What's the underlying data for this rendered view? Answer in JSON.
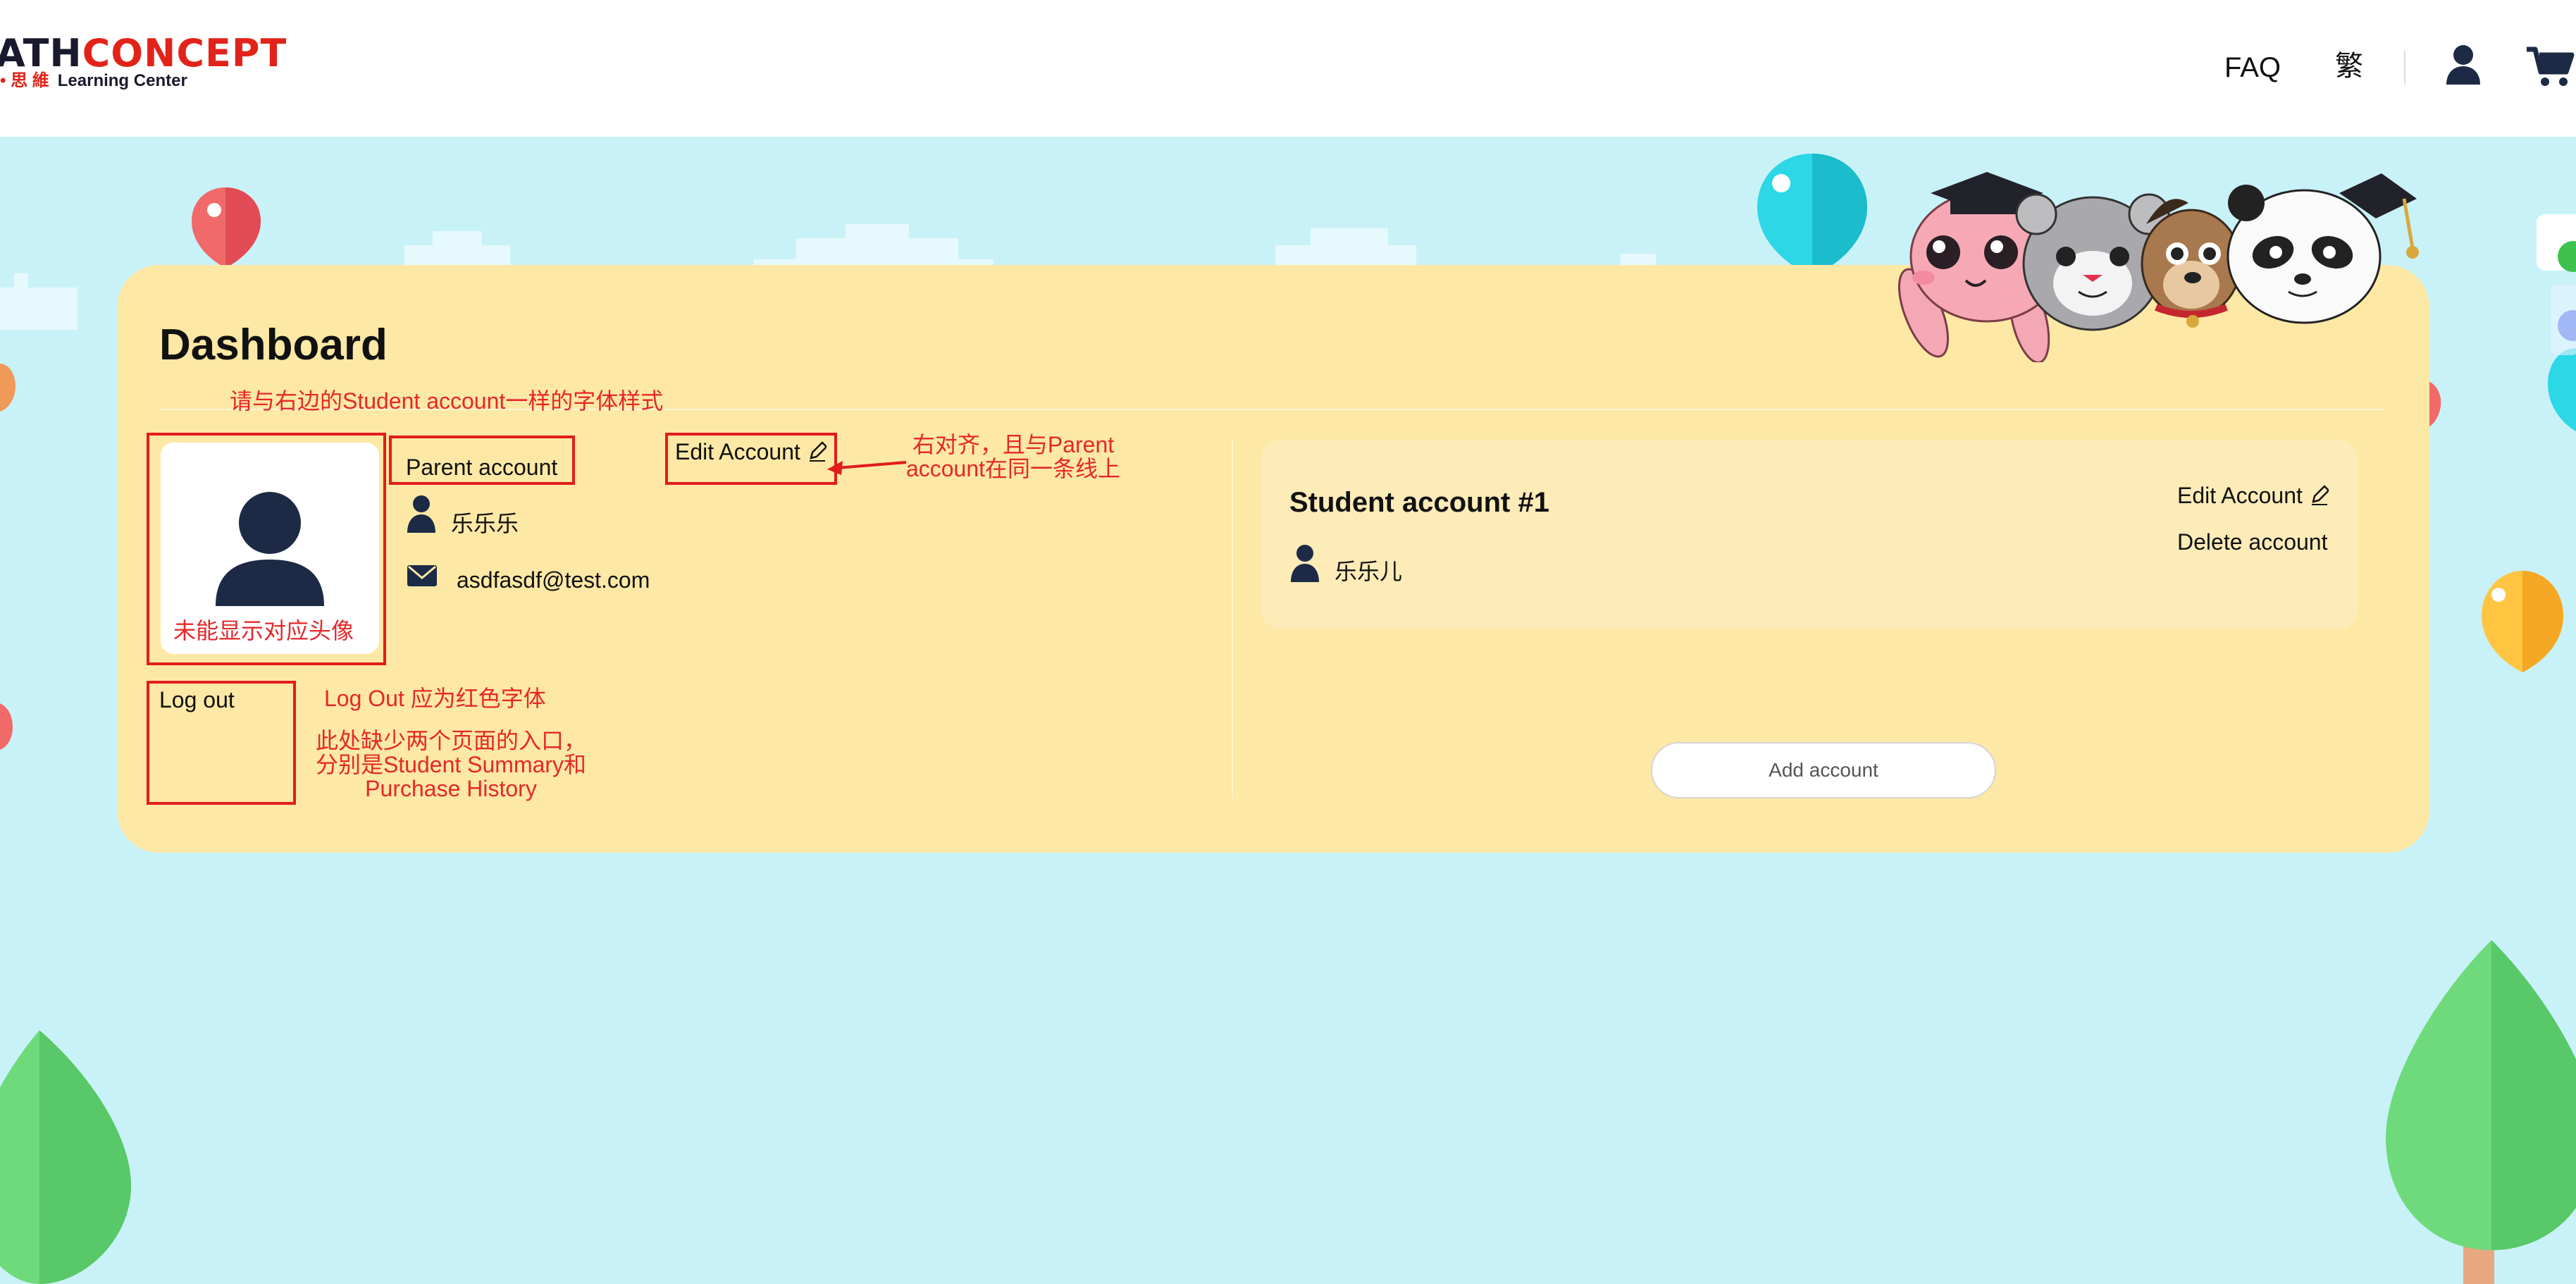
{
  "header": {
    "logo": {
      "part1": "ATH",
      "part2": "CONCEPT",
      "subtitle_cn": "• 思 維",
      "subtitle_en": "Learning Center"
    },
    "nav": {
      "faq": "FAQ",
      "language": "繁"
    }
  },
  "dashboard": {
    "title": "Dashboard",
    "parent": {
      "heading": "Parent account",
      "edit_label": "Edit Account",
      "name": "乐乐乐",
      "email": "asdfasdf@test.com",
      "logout_label": "Log out"
    },
    "student": {
      "heading": "Student account #1",
      "edit_label": "Edit Account",
      "delete_label": "Delete account",
      "name": "乐乐儿"
    },
    "add_account_label": "Add account"
  },
  "annotations": {
    "font_style_note": "请与右边的Student account一样的字体样式",
    "align_note_line1": "右对齐，且与Parent",
    "align_note_line2": "account在同一条线上",
    "avatar_note": "未能显示对应头像",
    "logout_note": "Log Out 应为红色字体",
    "missing_note_line1": "此处缺少两个页面的入口，",
    "missing_note_line2": "分别是Student Summary和",
    "missing_note_line3": "Purchase History"
  },
  "colors": {
    "background": "#c9f2f8",
    "card": "#fde8a5",
    "annotation_red": "#e21c1c",
    "brand_red": "#e2231a",
    "icon_navy": "#1c2a45"
  }
}
